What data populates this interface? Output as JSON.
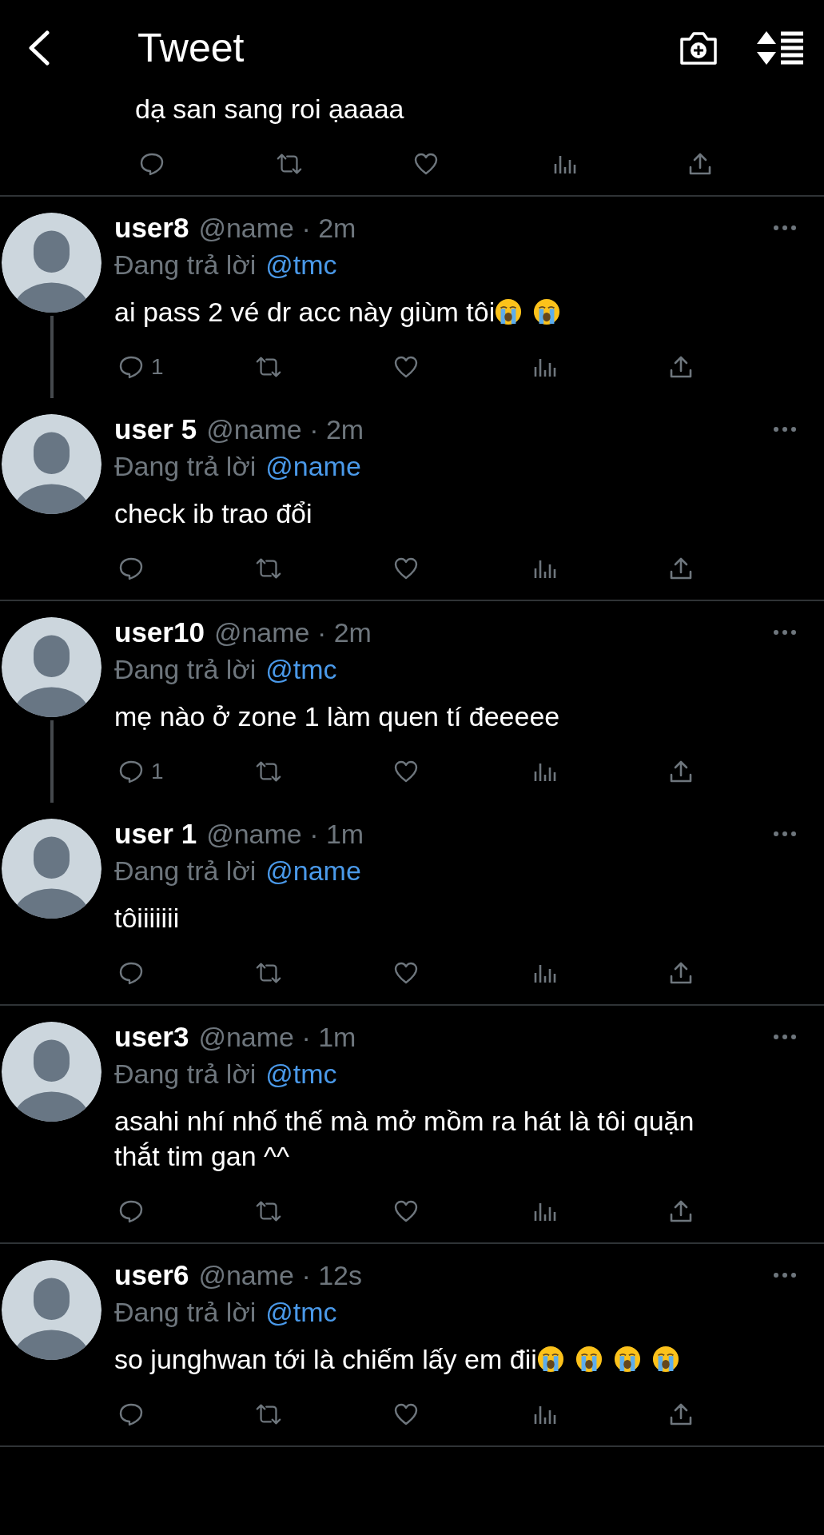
{
  "header": {
    "title": "Tweet"
  },
  "top_tweet": {
    "text": "dạ san sang roi ạaaaa"
  },
  "threads": [
    {
      "tweets": [
        {
          "name": "user8",
          "meta": "@name · 2m",
          "reply_prefix": "Đang trả lời",
          "reply_to": "@tmc",
          "text": "ai pass 2 vé dr acc này giùm tôi",
          "emojis": [
            {
              "kind": "loudly-crying"
            },
            {
              "kind": "loudly-crying"
            }
          ],
          "reply_count": "1"
        },
        {
          "name": "user 5",
          "meta": "@name · 2m",
          "reply_prefix": "Đang trả lời",
          "reply_to": "@name",
          "text": "check ib trao đổi"
        }
      ]
    },
    {
      "tweets": [
        {
          "name": "user10",
          "meta": "@name · 2m",
          "reply_prefix": "Đang trả lời",
          "reply_to": "@tmc",
          "text": "mẹ nào ở zone 1 làm quen tí đeeeee",
          "reply_count": "1"
        },
        {
          "name": "user 1",
          "meta": "@name · 1m",
          "reply_prefix": "Đang trả lời",
          "reply_to": "@name",
          "text": "tôiiiiiii"
        }
      ]
    },
    {
      "tweets": [
        {
          "name": "user3",
          "meta": "@name · 1m",
          "reply_prefix": "Đang trả lời",
          "reply_to": "@tmc",
          "text": "asahi nhí nhố thế mà mở mồm ra hát là tôi quặn thắt tim gan ^^"
        }
      ]
    },
    {
      "tweets": [
        {
          "name": "user6",
          "meta": "@name · 12s",
          "reply_prefix": "Đang trả lời",
          "reply_to": "@tmc",
          "text": "so junghwan tới là chiếm lấy em đii",
          "emojis": [
            {
              "kind": "loudly-crying"
            },
            {
              "kind": "loudly-crying"
            },
            {
              "kind": "loudly-crying"
            },
            {
              "kind": "loudly-crying"
            }
          ]
        }
      ]
    }
  ]
}
